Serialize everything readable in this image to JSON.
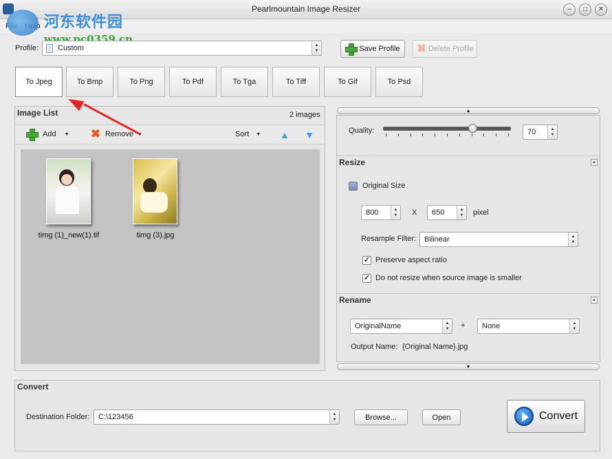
{
  "window": {
    "title": "Pearlmountain Image Resizer"
  },
  "watermark": {
    "site_name": "河东软件园",
    "url": "www.pc0359.cn"
  },
  "menu": [
    "File",
    "Help"
  ],
  "profile": {
    "label": "Profile:",
    "value": "Custom",
    "save_label": "Save Profile",
    "delete_label": "Delete Profile"
  },
  "formats": [
    "To Jpeg",
    "To Bmp",
    "To Png",
    "To Pdf",
    "To Tga",
    "To Tiff",
    "To Gif",
    "To Psd"
  ],
  "active_format": "To Jpeg",
  "image_list": {
    "title": "Image List",
    "count": "2 images",
    "add_label": "Add",
    "remove_label": "Remove",
    "sort_label": "Sort",
    "items": [
      {
        "name": "timg (1)_new(1).tif"
      },
      {
        "name": "timg (3).jpg"
      }
    ]
  },
  "quality": {
    "label": "Quality:",
    "value": "70",
    "level_percent": 70
  },
  "resize": {
    "title": "Resize",
    "original_size_label": "Original Size",
    "original_size_checked": false,
    "width": "800",
    "x_label": "X",
    "height": "650",
    "unit": "pixel",
    "resample_label": "Resample Filter:",
    "resample_value": "Bilinear",
    "preserve_label": "Preserve aspect ratio",
    "preserve_checked": true,
    "no_upscale_label": "Do not resize when source image is smaller",
    "no_upscale_checked": true
  },
  "rename": {
    "title": "Rename",
    "first": "OriginalName",
    "plus": "+",
    "second": "None",
    "output_label": "Output Name:",
    "output_value": "{Original Name}.jpg"
  },
  "convert": {
    "title": "Convert",
    "dest_label": "Destination Folder:",
    "dest_value": "C:\\123456",
    "browse_label": "Browse...",
    "open_label": "Open",
    "convert_label": "Convert"
  }
}
